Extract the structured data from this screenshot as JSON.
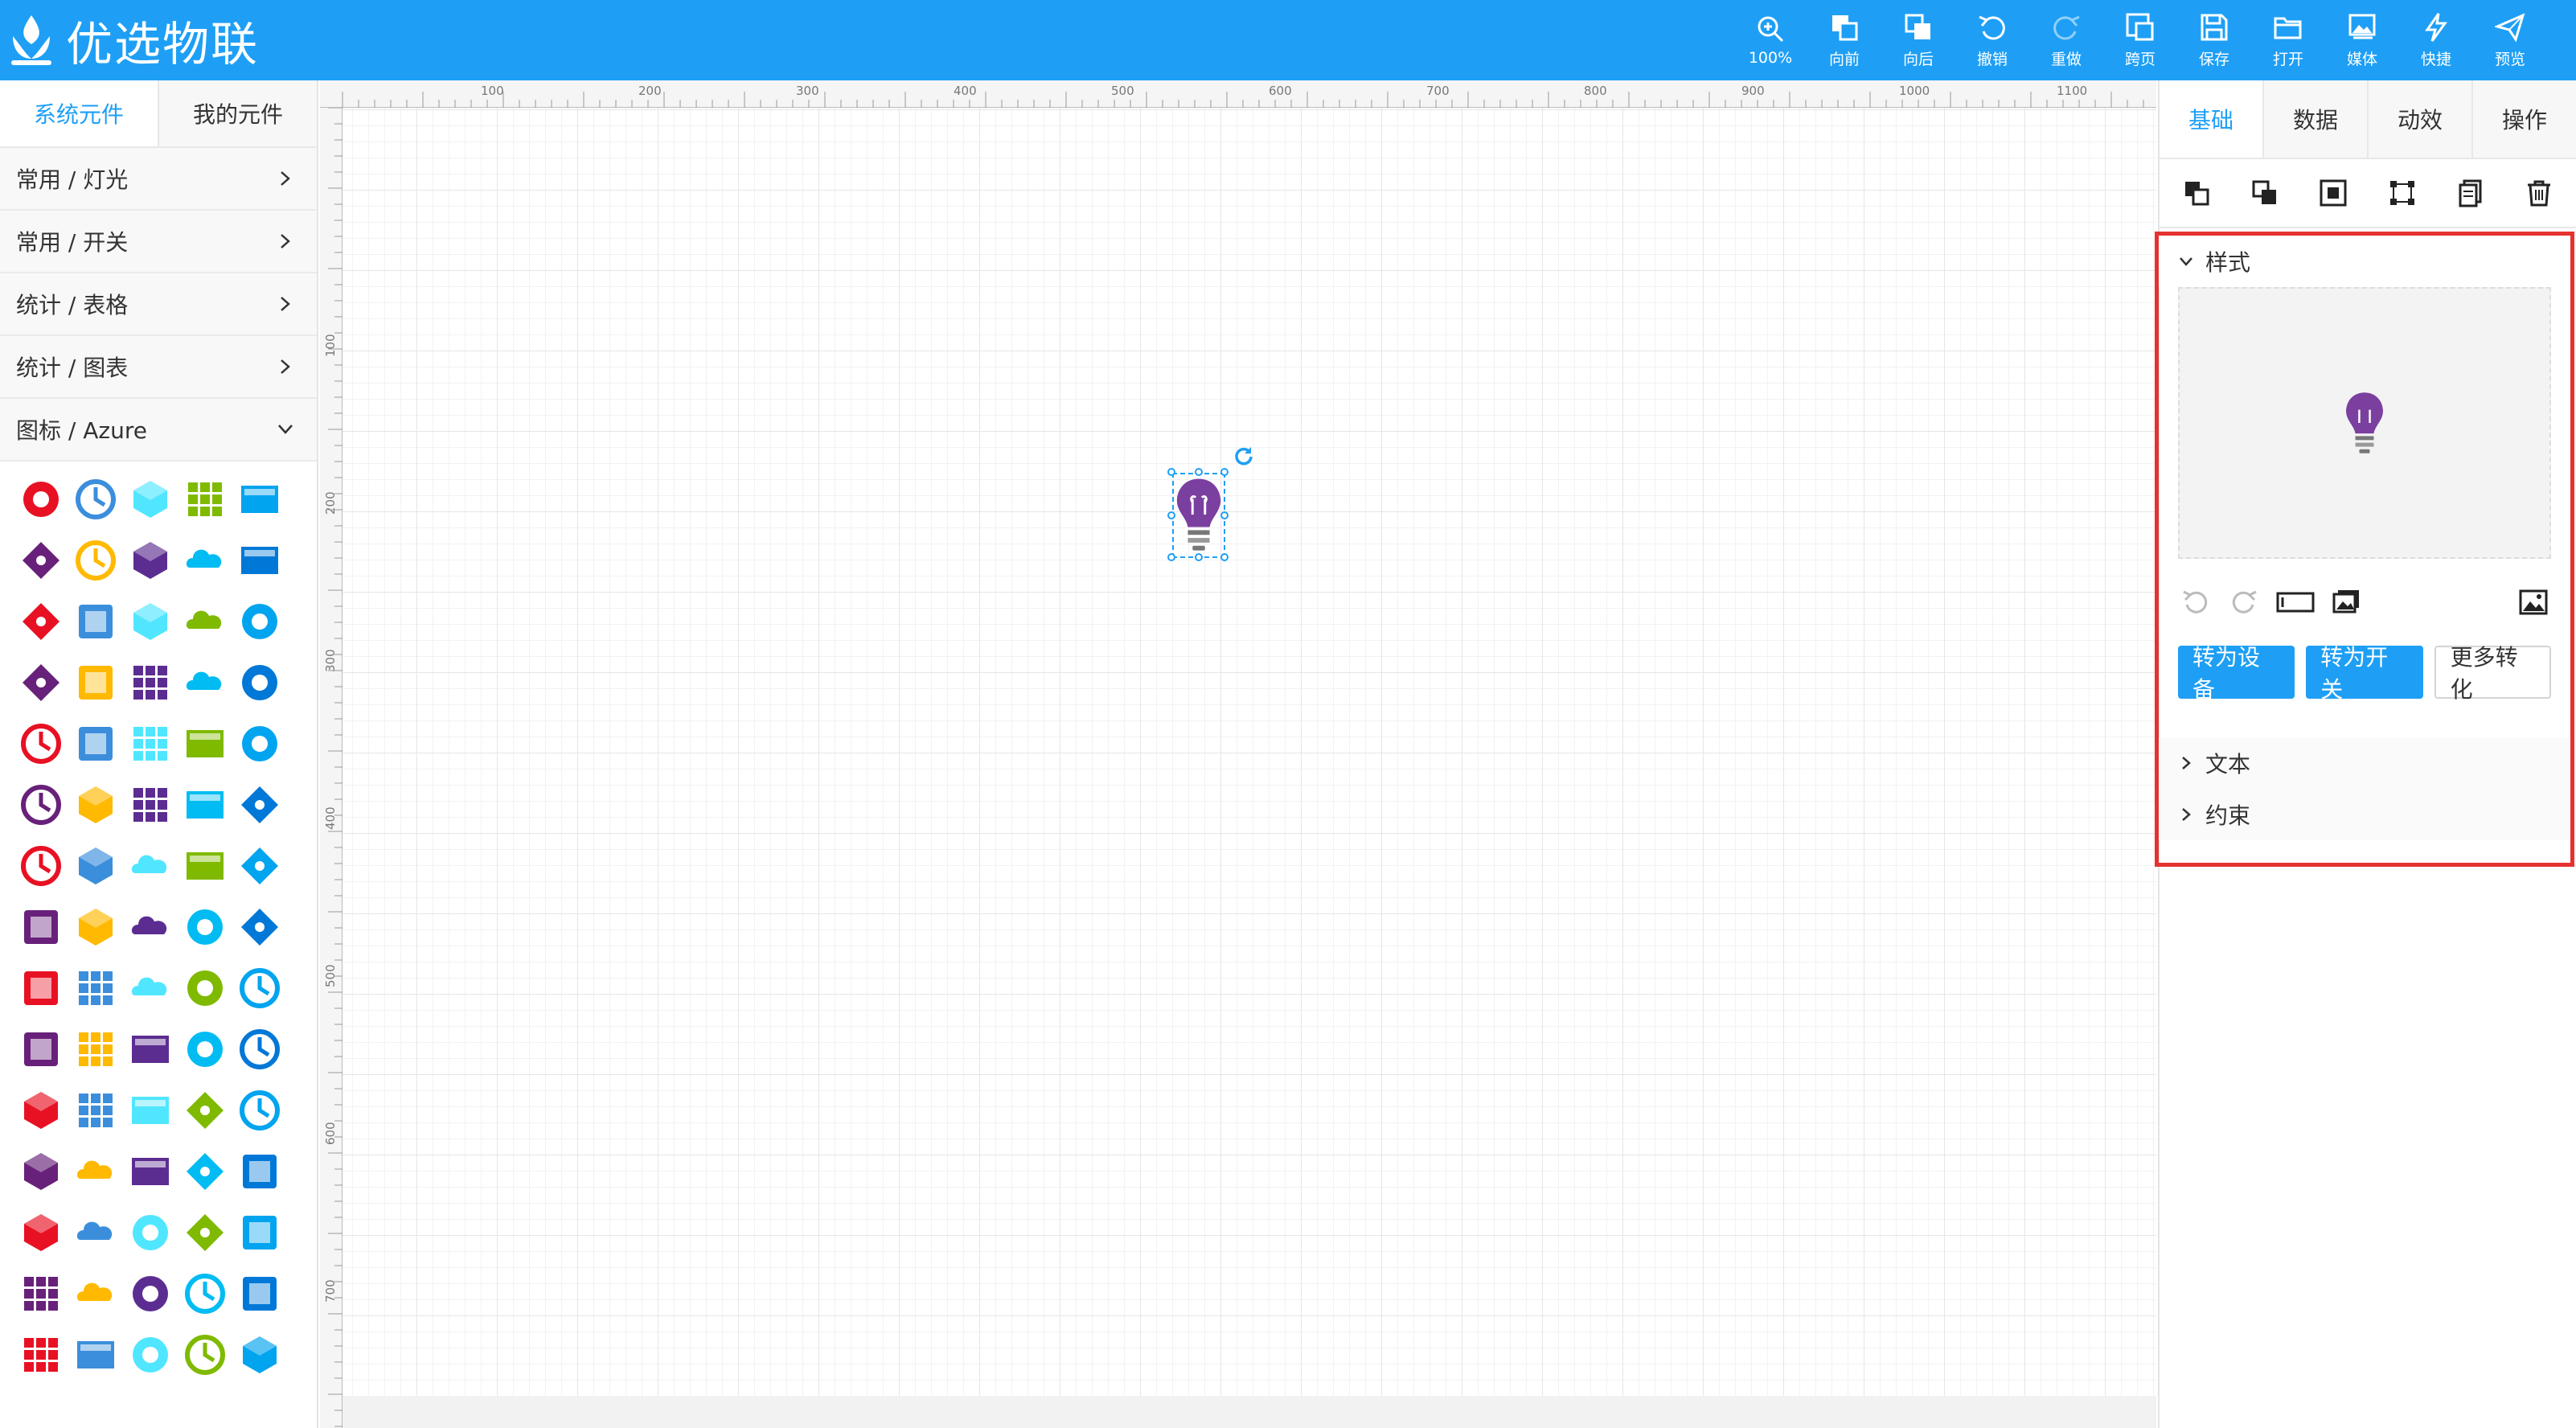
{
  "app": {
    "title": "优选物联"
  },
  "toolbar": [
    {
      "label": "100%",
      "icon": "zoom-icon"
    },
    {
      "label": "向前",
      "icon": "bring-forward-icon"
    },
    {
      "label": "向后",
      "icon": "send-backward-icon"
    },
    {
      "label": "撤销",
      "icon": "undo-icon"
    },
    {
      "label": "重做",
      "icon": "redo-icon"
    },
    {
      "label": "跨页",
      "icon": "cross-page-icon"
    },
    {
      "label": "保存",
      "icon": "save-icon"
    },
    {
      "label": "打开",
      "icon": "open-folder-icon"
    },
    {
      "label": "媒体",
      "icon": "media-icon"
    },
    {
      "label": "快捷",
      "icon": "lightning-icon"
    },
    {
      "label": "预览",
      "icon": "send-icon"
    }
  ],
  "left_panel": {
    "tabs": [
      {
        "label": "系统元件",
        "active": true
      },
      {
        "label": "我的元件",
        "active": false
      }
    ],
    "categories": [
      {
        "label": "常用 / 灯光",
        "expanded": false
      },
      {
        "label": "常用 / 开关",
        "expanded": false
      },
      {
        "label": "统计 / 表格",
        "expanded": false
      },
      {
        "label": "统计 / 图表",
        "expanded": false
      },
      {
        "label": "图标 / Azure",
        "expanded": true
      }
    ]
  },
  "ruler": {
    "top": [
      "100",
      "200",
      "300",
      "400",
      "500",
      "600",
      "700",
      "800",
      "900",
      "1000",
      "1100"
    ],
    "left": [
      "100",
      "200",
      "300",
      "400",
      "500",
      "600",
      "700"
    ]
  },
  "right_panel": {
    "tabs": [
      {
        "label": "基础",
        "active": true
      },
      {
        "label": "数据"
      },
      {
        "label": "动效"
      },
      {
        "label": "操作"
      }
    ],
    "style_section": {
      "label": "样式"
    },
    "buttons": {
      "to_device": "转为设备",
      "to_switch": "转为开关",
      "more": "更多转化"
    },
    "text_section": {
      "label": "文本"
    },
    "constraint_section": {
      "label": "约束"
    }
  },
  "colors": {
    "header": "#1e9ff5",
    "accent": "#1e9ff5",
    "highlight_border": "#e5312f",
    "bulb": "#7b3fa0"
  }
}
